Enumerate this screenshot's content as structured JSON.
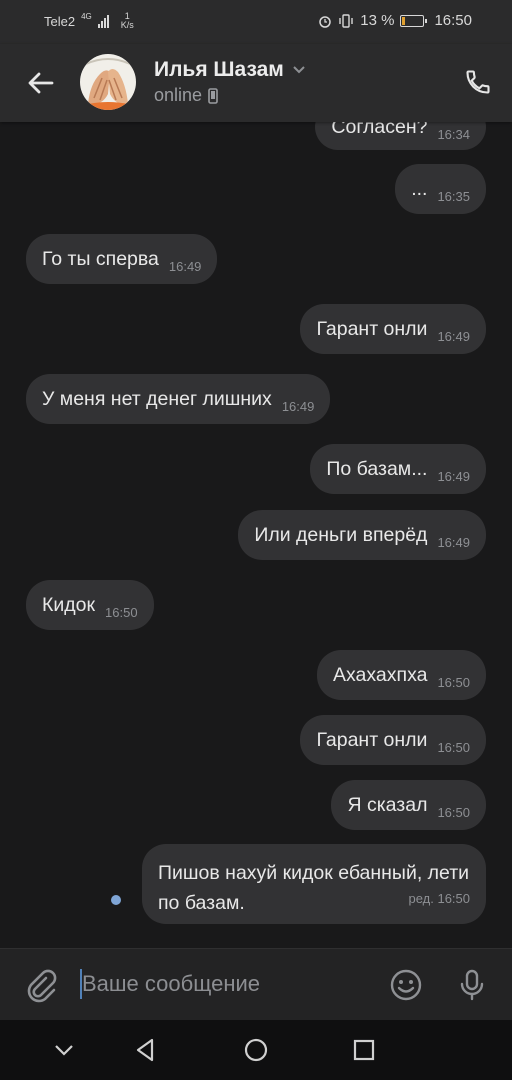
{
  "status_bar": {
    "carrier": "Tele2",
    "network": "4G",
    "speed_value": "1",
    "speed_unit": "K/s",
    "battery": "13 %",
    "battery_level": 0.13,
    "time": "16:50"
  },
  "header": {
    "contact_name": "Илья Шазам",
    "status": "online",
    "icons": [
      "back-arrow-icon",
      "chevron-down-icon",
      "mobile-device-icon",
      "phone-icon"
    ]
  },
  "messages": [
    {
      "side": "out",
      "text": "Согласен?",
      "time": "16:34"
    },
    {
      "side": "out",
      "text": "...",
      "time": "16:35"
    },
    {
      "side": "in",
      "text": "Го ты сперва",
      "time": "16:49"
    },
    {
      "side": "out",
      "text": "Гарант онли",
      "time": "16:49"
    },
    {
      "side": "in",
      "text": "У меня нет денег лишних",
      "time": "16:49"
    },
    {
      "side": "out",
      "text": "По базам...",
      "time": "16:49"
    },
    {
      "side": "out",
      "text": "Или деньги вперёд",
      "time": "16:49"
    },
    {
      "side": "in",
      "text": "Кидок",
      "time": "16:50"
    },
    {
      "side": "out",
      "text": "Ахахахпха",
      "time": "16:50"
    },
    {
      "side": "out",
      "text": "Гарант онли",
      "time": "16:50"
    },
    {
      "side": "out",
      "text": "Я сказал",
      "time": "16:50"
    },
    {
      "side": "out",
      "text": "Пишов нахуй кидок ебанный, лети по базам.",
      "time": "ред. 16:50",
      "unread": true
    }
  ],
  "composer": {
    "placeholder": "Ваше сообщение",
    "icons": [
      "attach-icon",
      "emoji-icon",
      "microphone-icon"
    ]
  },
  "nav": {
    "icons": [
      "chevron-down-icon",
      "back-triangle-icon",
      "home-circle-icon",
      "recents-square-icon"
    ]
  },
  "colors": {
    "background": "#19191a",
    "header": "#2b2b2c",
    "bubble": "#323234",
    "accent": "#5181b8",
    "unread_dot": "#7fa5d6"
  }
}
